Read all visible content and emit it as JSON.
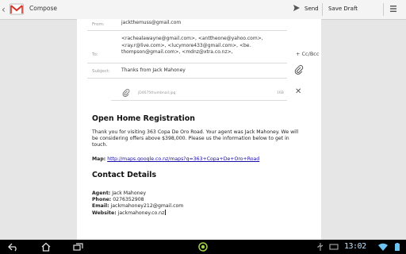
{
  "action_bar": {
    "title": "Compose",
    "send_label": "Send",
    "save_label": "Save Draft"
  },
  "compose": {
    "from_label": "From:",
    "from_value": "jackthemuss@gmail.com",
    "to_label": "To:",
    "to_value_lines": [
      "<rachealawayne@gmail.com>, <anttheone@yahoo.com>,",
      "<ray.r@live.com>, <lucymore433@gmail.com>, <be.",
      "thompson@gmail.com>, <mdnz@xtra.co.nz>,"
    ],
    "cc_bcc_label": "+ Cc/Bcc",
    "subject_label": "Subject:",
    "subject_value": "Thanks from Jack Mahoney",
    "attachment": {
      "name": "jD4675thumbnail.jpg",
      "size": "16B"
    }
  },
  "message": {
    "heading1": "Open Home Registration",
    "para_lines": [
      "Thank you for visiting 363 Copa De Oro Road. Your agent was Jack Mahoney. We will",
      "be considering offers above $398,000. Please us the information below to get in",
      "touch."
    ],
    "map_label": "Map:",
    "map_link": "http://maps.google.co.nz/maps?q=363+Copa+De+Oro+Road",
    "heading2": "Contact Details",
    "agent_label": "Agent:",
    "agent_value": "Jack Mahoney",
    "phone_label": "Phone:",
    "phone_value": "0276352908",
    "email_label": "Email:",
    "email_value": "jackmahoney212@gmail.com",
    "website_label": "Website:",
    "website_value": "jackmahoney.co.nz"
  },
  "status": {
    "clock": "13:02"
  }
}
